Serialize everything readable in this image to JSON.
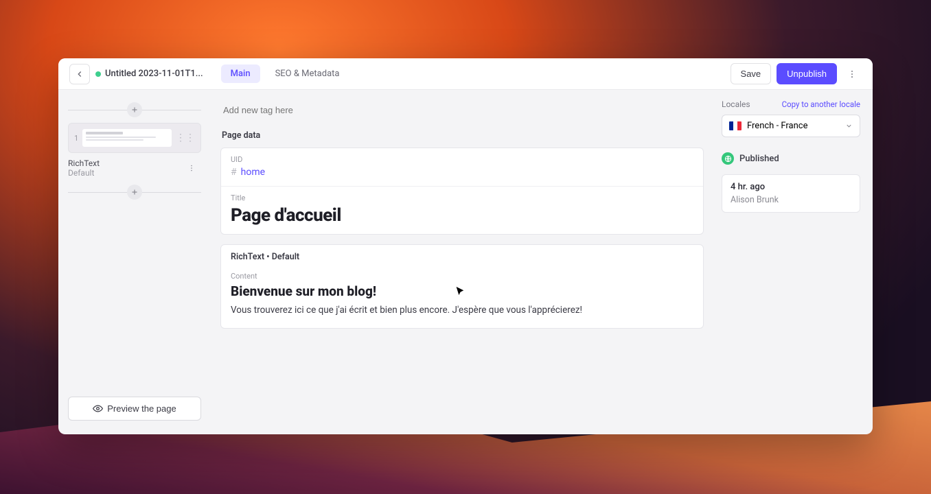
{
  "header": {
    "doc_title": "Untitled 2023-11-01T1...",
    "tabs": {
      "main": "Main",
      "seo": "SEO & Metadata"
    },
    "save_label": "Save",
    "unpublish_label": "Unpublish"
  },
  "left": {
    "slice_number": "1",
    "slice_name": "RichText",
    "slice_variant": "Default",
    "preview_label": "Preview the page"
  },
  "main": {
    "tag_placeholder": "Add new tag here",
    "page_data_label": "Page data",
    "uid_label": "UID",
    "uid_value": "home",
    "title_label": "Title",
    "title_value": "Page d'accueil",
    "slice_header": "RichText • Default",
    "content_label": "Content",
    "content_heading": "Bienvenue sur mon blog!",
    "content_body": "Vous trouverez ici ce que j'ai écrit et bien plus encore. J'espère que vous l'apprécierez!"
  },
  "right": {
    "locales_label": "Locales",
    "copy_label": "Copy to another locale",
    "locale_name": "French - France",
    "status_label": "Published",
    "history_time": "4 hr. ago",
    "history_user": "Alison Brunk"
  }
}
